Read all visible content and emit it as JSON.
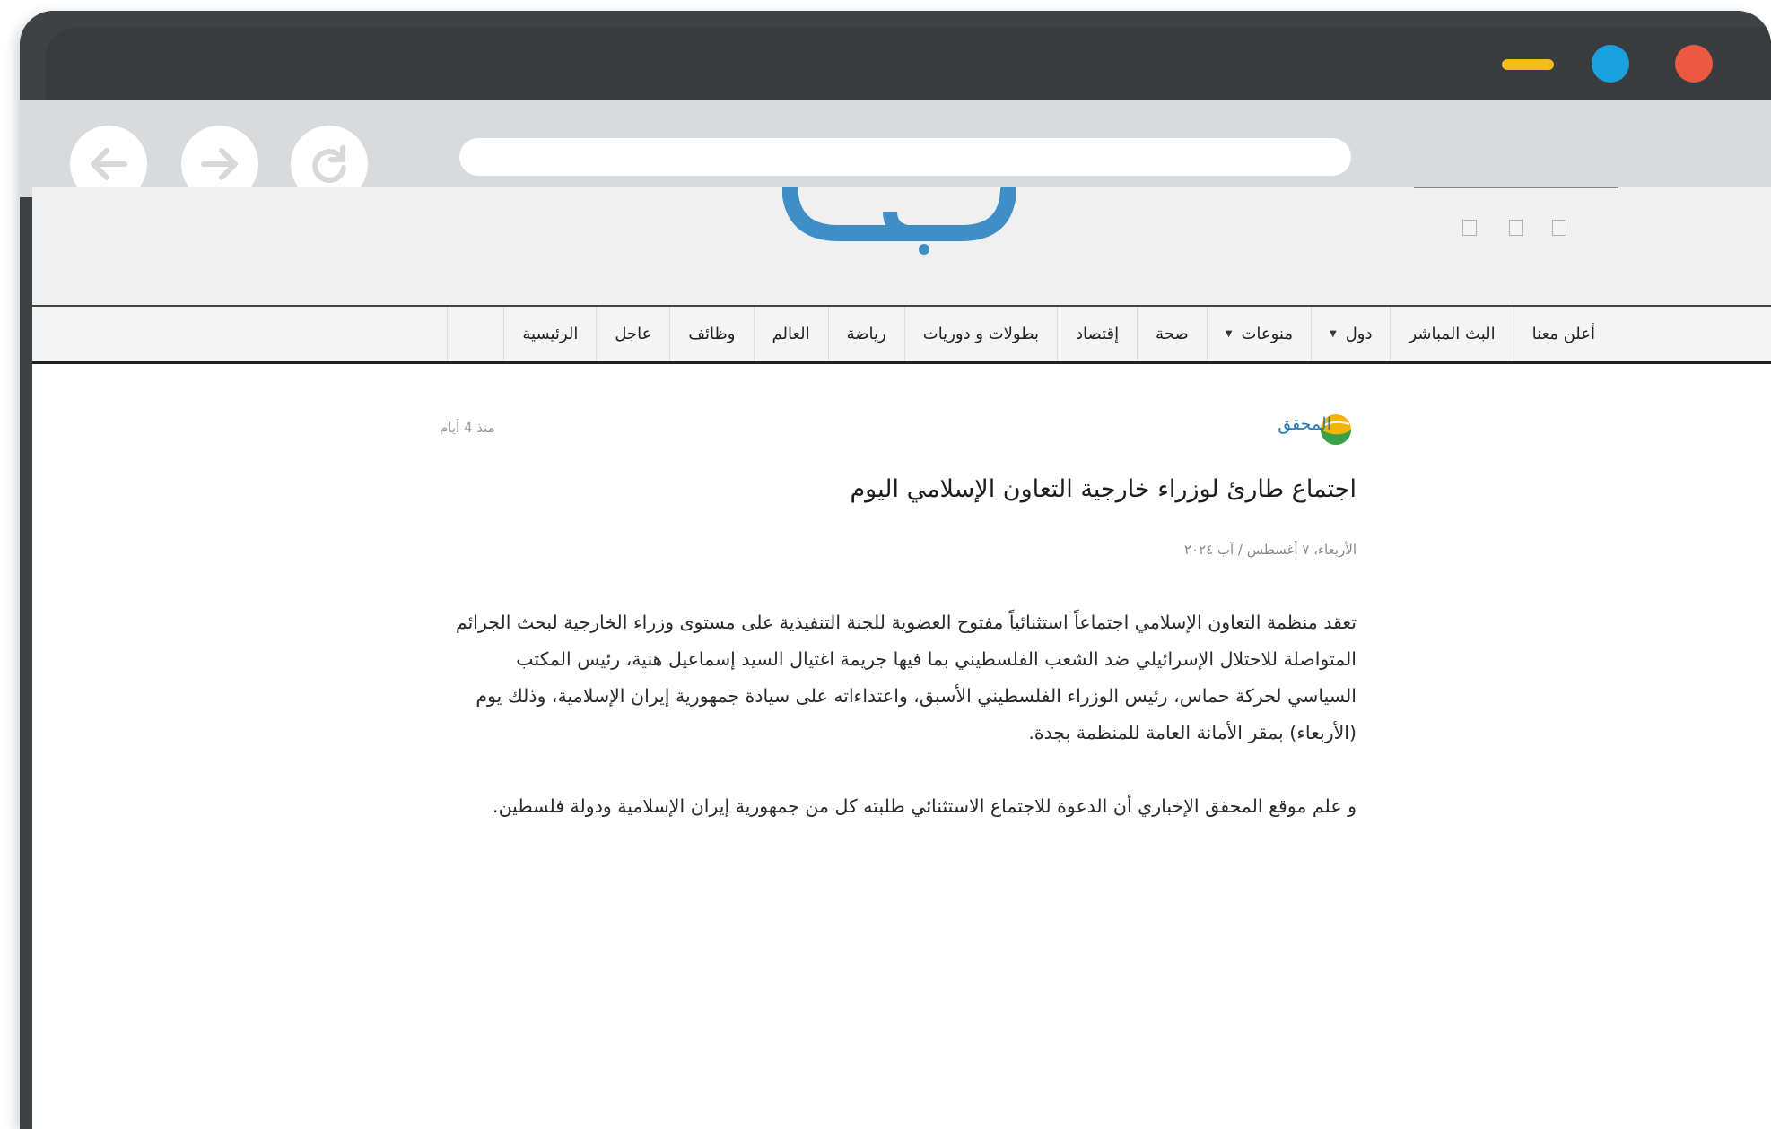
{
  "browser": {
    "icons": {
      "back": "arrow-left-icon",
      "forward": "arrow-right-icon",
      "reload": "reload-icon",
      "minimize": "minimize-icon",
      "maximize": "maximize-icon",
      "close": "close-icon"
    },
    "colors": {
      "minimize": "#f2bd1b",
      "maximize": "#1ba1dd",
      "close": "#ec5841"
    }
  },
  "site": {
    "logo_color": "#3f8fc6",
    "menu": [
      {
        "label": "الرئيسية",
        "dropdown": false
      },
      {
        "label": "عاجل",
        "dropdown": false
      },
      {
        "label": "وظائف",
        "dropdown": false
      },
      {
        "label": "العالم",
        "dropdown": false
      },
      {
        "label": "رياضة",
        "dropdown": false
      },
      {
        "label": "بطولات و دوريات",
        "dropdown": false
      },
      {
        "label": "إقتصاد",
        "dropdown": false
      },
      {
        "label": "صحة",
        "dropdown": false
      },
      {
        "label": "منوعات",
        "dropdown": true
      },
      {
        "label": "دول",
        "dropdown": true
      },
      {
        "label": "البث المباشر",
        "dropdown": false
      },
      {
        "label": "أعلن معنا",
        "dropdown": false
      }
    ]
  },
  "article": {
    "source": "المحقق",
    "time_ago": "منذ 4 أيام",
    "headline": "اجتماع طارئ لوزراء خارجية التعاون الإسلامي اليوم",
    "dateline": "الأربعاء، ٧ أغسطس / آب ٢٠٢٤",
    "paragraphs": [
      "تعقد منظمة التعاون الإسلامي اجتماعاً استثنائياً مفتوح العضوية للجنة التنفيذية على مستوى وزراء الخارجية لبحث الجرائم المتواصلة للاحتلال الإسرائيلي ضد الشعب الفلسطيني بما فيها جريمة اغتيال السيد إسماعيل هنية، رئيس المكتب السياسي لحركة حماس، رئيس الوزراء الفلسطيني الأسبق، واعتداءاته على سيادة جمهورية إيران الإسلامية، وذلك يوم (الأربعاء) بمقر الأمانة العامة للمنظمة بجدة.",
      "و علم موقع المحقق الإخباري أن الدعوة للاجتماع الاستثنائي طلبته كل من جمهورية إيران الإسلامية ودولة فلسطين."
    ]
  }
}
